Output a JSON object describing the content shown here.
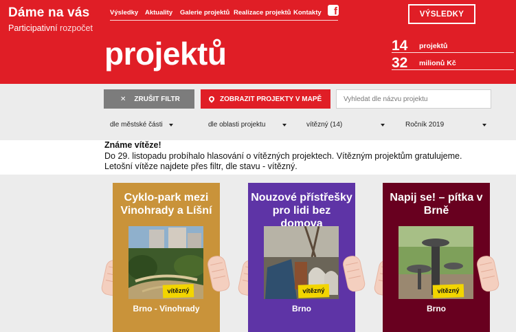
{
  "brand": {
    "title": "Dáme na vás",
    "subtitle_strong": "Participativní",
    "subtitle_light": " rozpočet"
  },
  "nav": {
    "items": [
      "Výsledky",
      "Aktuality",
      "Galerie projektů",
      "Realizace projektů",
      "Kontakty"
    ],
    "facebook_icon": "facebook-icon"
  },
  "header": {
    "results_button": "VÝSLEDKY",
    "page_title": "projektů",
    "stats": [
      {
        "value": "14",
        "label": "projektů"
      },
      {
        "value": "32",
        "label": "milionů Kč"
      }
    ]
  },
  "filters": {
    "clear_label": "ZRUŠIT FILTR",
    "map_label": "ZOBRAZIT PROJEKTY V MAPĚ",
    "search_placeholder": "Vyhledat dle názvu projektu",
    "selects": [
      "dle městské části",
      "dle oblasti projektu",
      "vítězný (14)",
      "Ročník 2019"
    ]
  },
  "notice": {
    "title": "Známe vítěze!",
    "lines": [
      "Do 29. listopadu probíhalo hlasování o vítězných projektech. Vítězným projektům gratulujeme.",
      "Letošní vítěze najdete přes filtr, dle stavu - vítězný."
    ]
  },
  "cards": [
    {
      "title": "Cyklo-park mezi Vinohrady a Líšní",
      "badge": "vítězný",
      "place": "Brno - Vinohrady",
      "color": "#c9933a"
    },
    {
      "title": "Nouzové přístřešky pro lidi bez domova",
      "badge": "vítězný",
      "place": "Brno",
      "color": "#5e34a6"
    },
    {
      "title": "Napij se! – pítka v Brně",
      "badge": "vítězný",
      "place": "Brno",
      "color": "#68001f"
    }
  ],
  "colors": {
    "brand_red": "#e01e26",
    "badge_yellow": "#f2d500",
    "band_gray": "#ececec"
  }
}
